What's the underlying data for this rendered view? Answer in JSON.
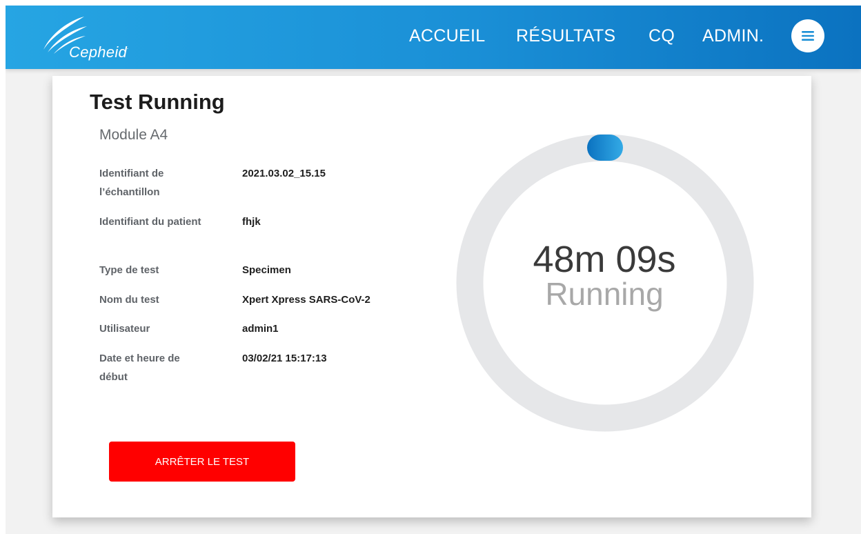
{
  "header": {
    "brand": "Cepheid",
    "brand_reg": ".",
    "nav": {
      "home": "ACCUEIL",
      "results": "RÉSULTATS",
      "qc": "CQ",
      "admin": "ADMIN."
    },
    "menu_icon": "hamburger-menu-icon"
  },
  "test": {
    "title": "Test Running",
    "module": "Module A4",
    "details": [
      {
        "label": "Identifiant de l’échantillon",
        "value": "2021.03.02_15.15"
      },
      {
        "label": "Identifiant du patient",
        "value": "fhjk"
      },
      {
        "label": "Type de test",
        "value": "Specimen"
      },
      {
        "label": "Nom du test",
        "value": "Xpert Xpress SARS-CoV-2"
      },
      {
        "label": "Utilisateur",
        "value": "admin1"
      },
      {
        "label": "Date et heure de début",
        "value": "03/02/21 15:17:13"
      }
    ],
    "stop_button": "ARRÊTER LE TEST"
  },
  "timer": {
    "time": "48m 09s",
    "status": "Running",
    "progress_fraction": 0.0
  },
  "colors": {
    "header_start": "#26a5e3",
    "header_end": "#0b72c0",
    "stop_button": "#ff0000",
    "ring_track": "#e6e7e9",
    "ring_indicator": "#1a8fd6"
  }
}
